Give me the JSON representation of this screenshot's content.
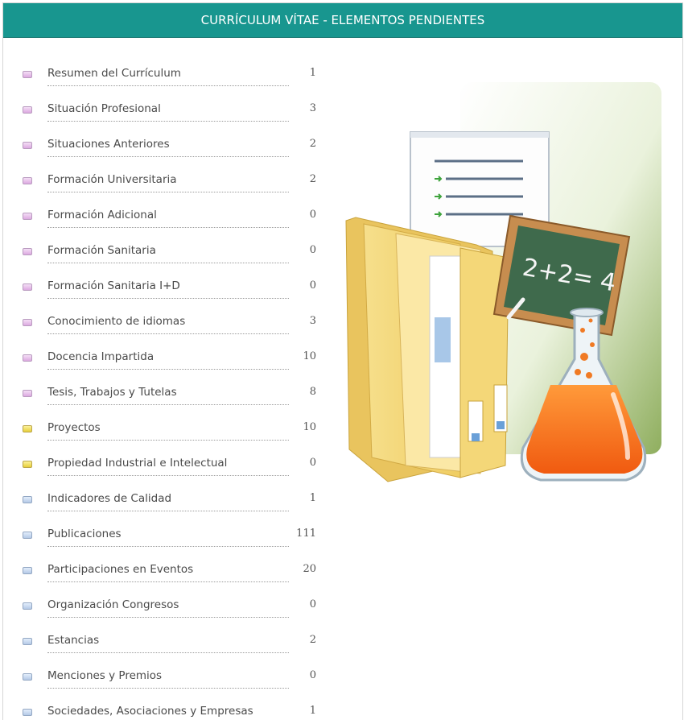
{
  "header": {
    "title": "CURRÍCULUM VÍTAE - ELEMENTOS PENDIENTES"
  },
  "colors": {
    "header_bg": "#18968f",
    "pink_bullet": "#dca8e0",
    "yellow_bullet": "#e6cf3a",
    "blue_bullet": "#b4c9e6"
  },
  "items": [
    {
      "label": "Resumen del Currículum",
      "count": "1",
      "color": "pink"
    },
    {
      "label": "Situación Profesional",
      "count": "3",
      "color": "pink"
    },
    {
      "label": "Situaciones Anteriores",
      "count": "2",
      "color": "pink"
    },
    {
      "label": "Formación Universitaria",
      "count": "2",
      "color": "pink"
    },
    {
      "label": "Formación Adicional",
      "count": "0",
      "color": "pink"
    },
    {
      "label": "Formación Sanitaria",
      "count": "0",
      "color": "pink"
    },
    {
      "label": "Formación Sanitaria I+D",
      "count": "0",
      "color": "pink"
    },
    {
      "label": "Conocimiento de idiomas",
      "count": "3",
      "color": "pink"
    },
    {
      "label": "Docencia Impartida",
      "count": "10",
      "color": "pink"
    },
    {
      "label": "Tesis, Trabajos y Tutelas",
      "count": "8",
      "color": "pink"
    },
    {
      "label": "Proyectos",
      "count": "10",
      "color": "yellow"
    },
    {
      "label": "Propiedad Industrial e Intelectual",
      "count": "0",
      "color": "yellow"
    },
    {
      "label": "Indicadores de Calidad",
      "count": "1",
      "color": "blue"
    },
    {
      "label": "Publicaciones",
      "count": "111",
      "color": "blue"
    },
    {
      "label": "Participaciones en Eventos",
      "count": "20",
      "color": "blue"
    },
    {
      "label": "Organización Congresos",
      "count": "0",
      "color": "blue"
    },
    {
      "label": "Estancias",
      "count": "2",
      "color": "blue"
    },
    {
      "label": "Menciones y Premios",
      "count": "0",
      "color": "blue"
    },
    {
      "label": "Sociedades, Asociaciones y Empresas",
      "count": "1",
      "color": "blue"
    }
  ],
  "illustration": {
    "icons": [
      "document-list-icon",
      "folder-icon",
      "chalkboard-icon",
      "flask-icon"
    ],
    "chalkboard_text": "2+2= 4"
  }
}
